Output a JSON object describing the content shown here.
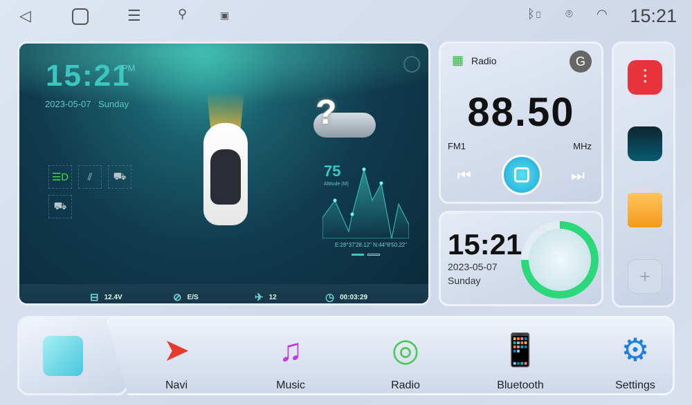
{
  "status_bar": {
    "time": "15:21",
    "icons": [
      "back-icon",
      "home-icon",
      "menu-icon",
      "usb-icon",
      "image-icon",
      "bluetooth-battery-icon",
      "location-icon",
      "wifi-icon"
    ]
  },
  "main_widget": {
    "time": "15:21",
    "ampm": "PM",
    "date": "2023-05-07",
    "day": "Sunday",
    "weather": "?",
    "altitude": "75",
    "altitude_label": "Altitude (M)",
    "coordinates": "E:28°37'28.12\" N:44°8'50.22\"",
    "voltage": "12.4V",
    "direction": "E/S",
    "satellites": "12",
    "trip_time": "00:03:29"
  },
  "radio": {
    "title": "Radio",
    "frequency": "88.50",
    "band": "FM1",
    "unit": "MHz"
  },
  "clock_widget": {
    "time": "15:21",
    "date": "2023-05-07",
    "day": "Sunday"
  },
  "dock": [
    {
      "label": "Navi"
    },
    {
      "label": "Music"
    },
    {
      "label": "Radio"
    },
    {
      "label": "Bluetooth"
    },
    {
      "label": "Settings"
    }
  ]
}
